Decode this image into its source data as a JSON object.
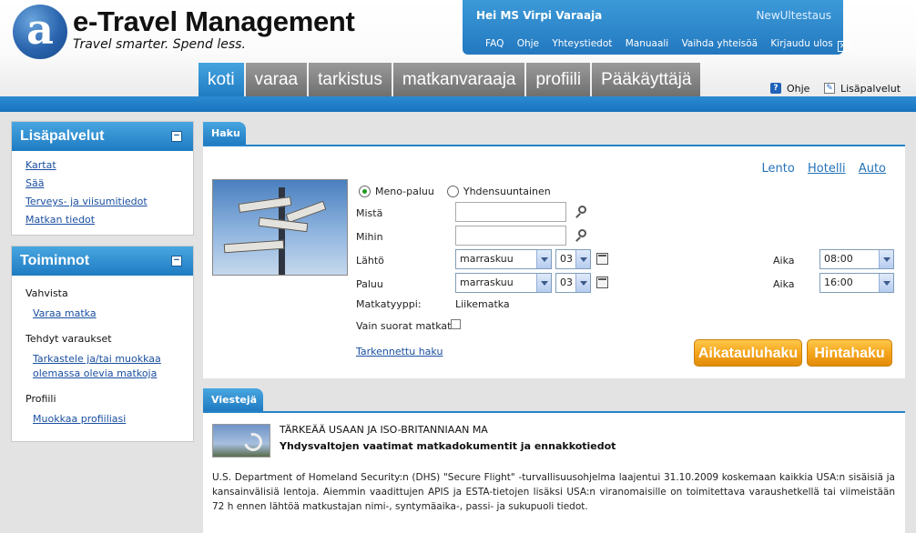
{
  "header": {
    "logo_letter": "a",
    "logo_title": "e-Travel Management",
    "logo_tagline": "Travel smarter. Spend less.",
    "greeting": "Hei MS Virpi Varaaja",
    "company": "NewUltestaus",
    "user_links": [
      "FAQ",
      "Ohje",
      "Yhteystiedot",
      "Manuaali",
      "Vaihda yhteisöä",
      "Kirjaudu ulos"
    ],
    "logout_icon": "close-icon"
  },
  "nav": {
    "tabs": [
      "koti",
      "varaa",
      "tarkistus",
      "matkanvaraaja",
      "profiili",
      "Pääkäyttäjä"
    ],
    "active": "koti"
  },
  "util": {
    "help": "Ohje",
    "services": "Lisäpalvelut"
  },
  "sidebar": {
    "extras": {
      "title": "Lisäpalvelut",
      "links": [
        "Kartat",
        "Sää",
        "Terveys- ja viisumitiedot",
        "Matkan tiedot"
      ]
    },
    "actions": {
      "title": "Toiminnot",
      "groups": [
        {
          "title": "Vahvista",
          "links": [
            "Varaa matka"
          ]
        },
        {
          "title": "Tehdyt varaukset",
          "links": [
            "Tarkastele ja/tai muokkaa olemassa olevia matkoja"
          ]
        },
        {
          "title": "Profiili",
          "links": [
            "Muokkaa profiiliasi"
          ]
        }
      ]
    }
  },
  "search": {
    "tab_label": "Haku",
    "modes": [
      "Lento",
      "Hotelli",
      "Auto"
    ],
    "trip_types": [
      "Meno-paluu",
      "Yhdensuuntainen"
    ],
    "selected_trip_type": "Meno-paluu",
    "from_label": "Mistä",
    "from_value": "",
    "to_label": "Mihin",
    "to_value": "",
    "depart": {
      "label": "Lähtö",
      "month": "marraskuu",
      "day": "03",
      "time_label": "Aika",
      "time": "08:00"
    },
    "return": {
      "label": "Paluu",
      "month": "marraskuu",
      "day": "03",
      "time_label": "Aika",
      "time": "16:00"
    },
    "trip_purpose_label": "Matkatyyppi:",
    "trip_purpose_value": "Liikematka",
    "direct_only_label": "Vain suorat matkat",
    "direct_only_checked": false,
    "advanced_link": "Tarkennettu haku",
    "schedule_button": "Aikatauluhaku",
    "price_button": "Hintahaku"
  },
  "messages": {
    "tab_label": "Viestejä",
    "title": "TÄRKEÄÄ USAAN JA ISO-BRITANNIAAN MA",
    "subtitle": "Yhdysvaltojen vaatimat matkadokumentit ja ennakkotiedot",
    "body": "U.S. Department of Homeland Security:n (DHS) \"Secure Flight\" -turvallisuusohjelma laajentui 31.10.2009 koskemaan kaikkia USA:n sisäisiä ja kansainvälisiä lentoja. Aiemmin vaadittujen APIS ja ESTA-tietojen lisäksi USA:n viranomaisille on toimitettava varaushetkellä tai viimeistään 72 h ennen lähtöä matkustajan nimi-, syntymäaika-, passi- ja sukupuoli tiedot."
  },
  "colors": {
    "primary_blue": "#1f7bc2",
    "nav_gray": "#6f6f6f",
    "button_orange": "#f5a51c",
    "link_blue": "#1a4fa0"
  }
}
